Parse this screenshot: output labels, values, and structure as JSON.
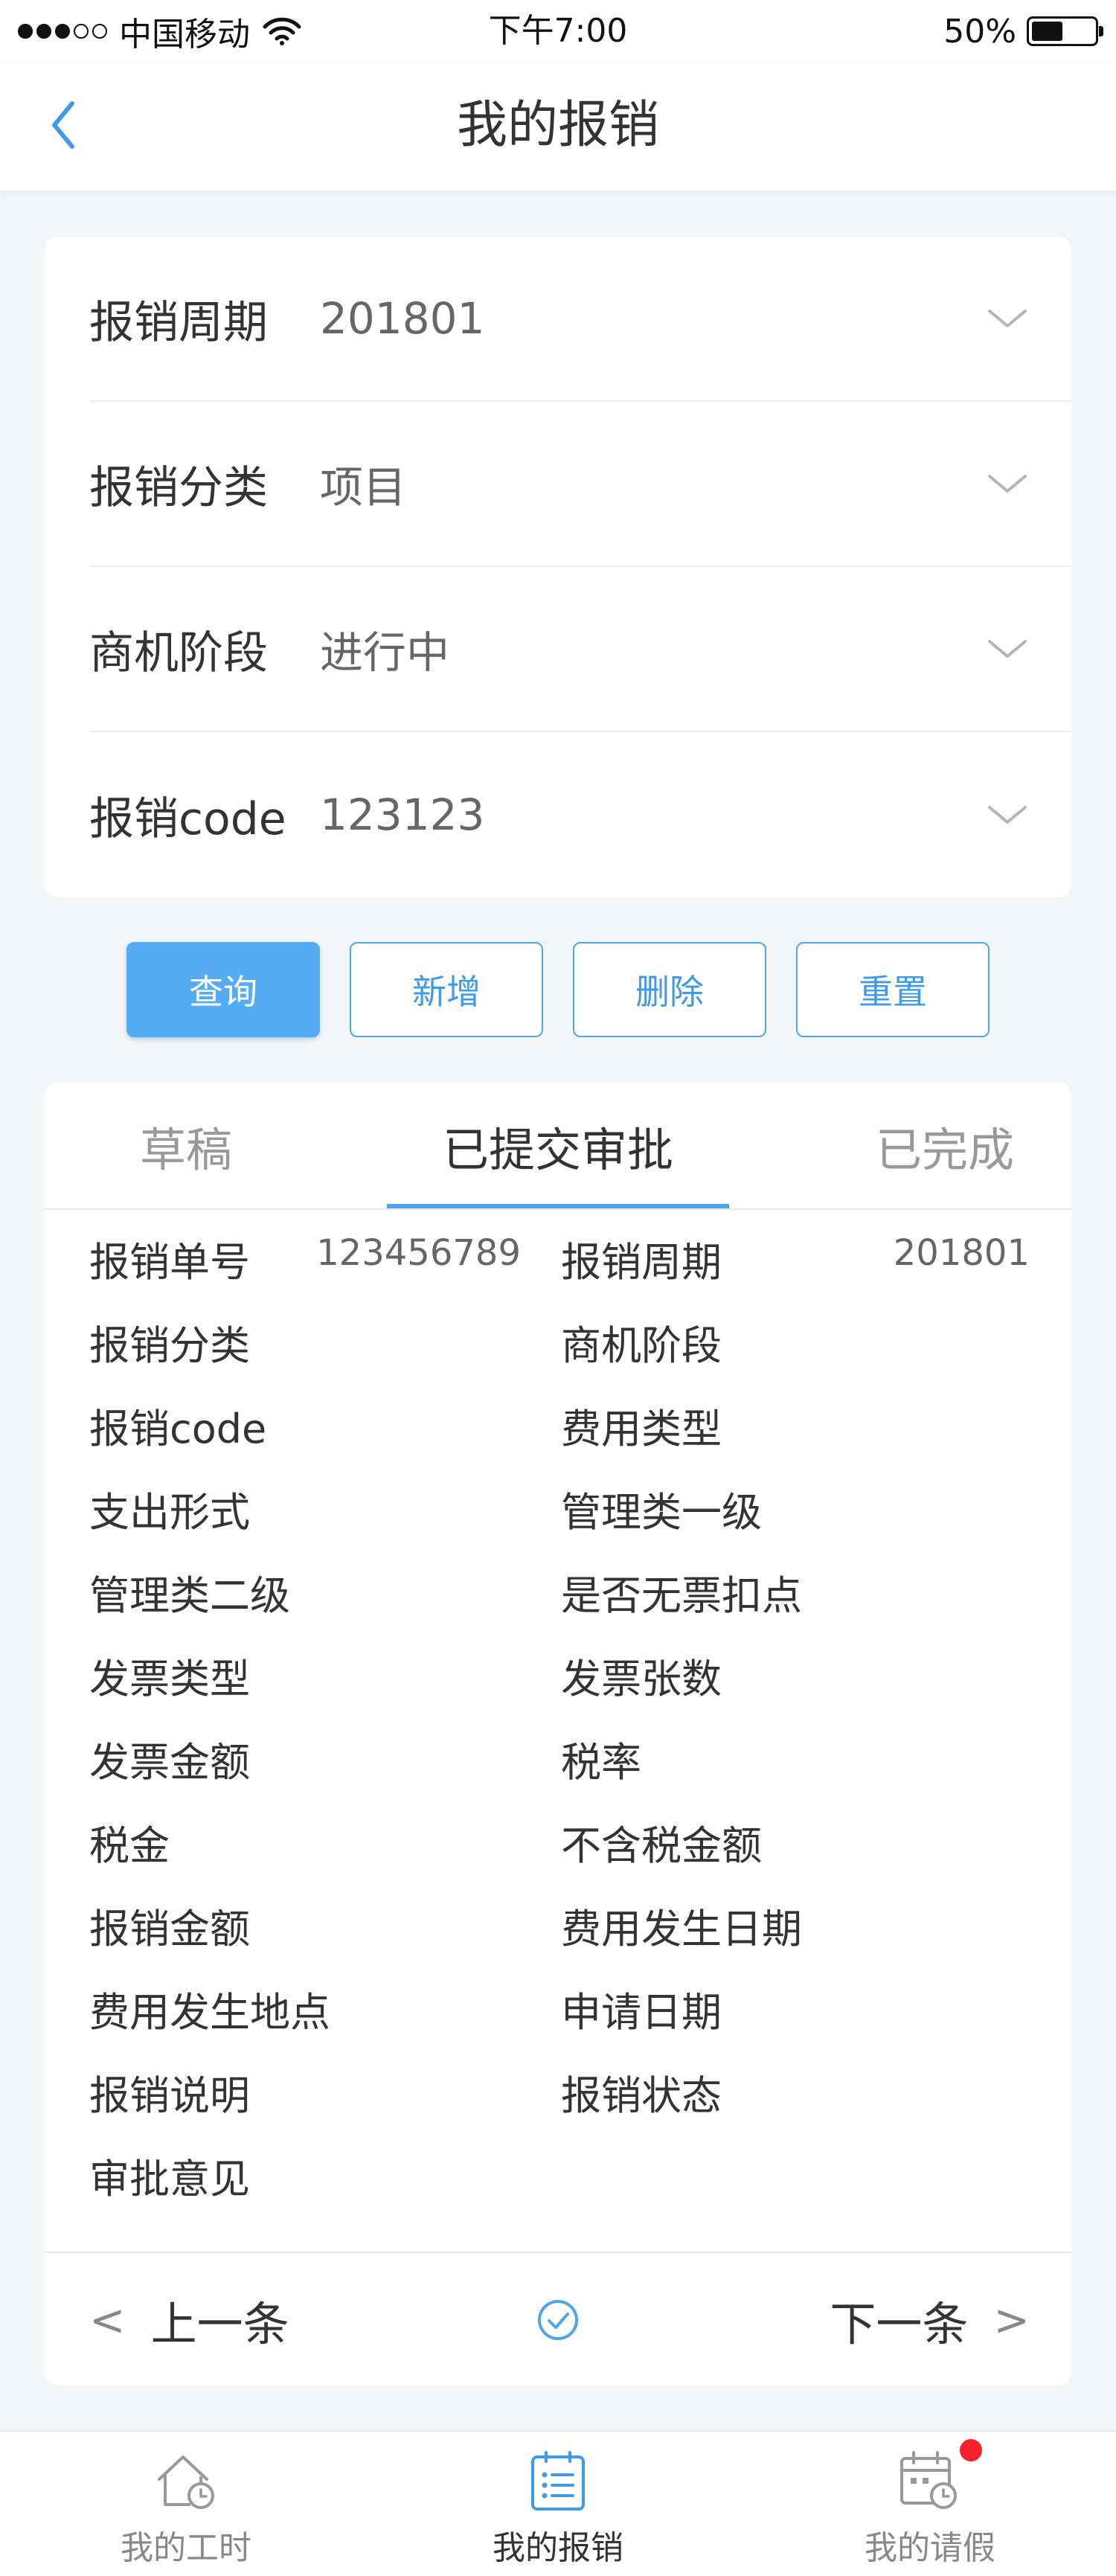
{
  "status_bar": {
    "carrier": "中国移动",
    "time": "下午7:00",
    "battery": "50%",
    "battery_level": 0.5
  },
  "nav": {
    "title": "我的报销",
    "back_icon": "chevron-left-icon"
  },
  "filters": [
    {
      "label": "报销周期",
      "value": "201801"
    },
    {
      "label": "报销分类",
      "value": "项目"
    },
    {
      "label": "商机阶段",
      "value": "进行中"
    },
    {
      "label": "报销code",
      "value": "123123"
    }
  ],
  "actions": {
    "query": "查询",
    "add": "新增",
    "delete": "删除",
    "reset": "重置"
  },
  "tabs": [
    {
      "label": "草稿",
      "active": false
    },
    {
      "label": "已提交审批",
      "active": true
    },
    {
      "label": "已完成",
      "active": false
    }
  ],
  "details": {
    "left": [
      {
        "label": "报销单号",
        "value": "123456789"
      },
      {
        "label": "报销分类",
        "value": ""
      },
      {
        "label": "报销code",
        "value": ""
      },
      {
        "label": "支出形式",
        "value": ""
      },
      {
        "label": "管理类二级",
        "value": ""
      },
      {
        "label": "发票类型",
        "value": ""
      },
      {
        "label": "发票金额",
        "value": ""
      },
      {
        "label": "税金",
        "value": ""
      },
      {
        "label": "报销金额",
        "value": ""
      },
      {
        "label": "费用发生地点",
        "value": ""
      },
      {
        "label": "报销说明",
        "value": ""
      },
      {
        "label": "审批意见",
        "value": ""
      }
    ],
    "right": [
      {
        "label": "报销周期",
        "value": "201801"
      },
      {
        "label": "商机阶段",
        "value": ""
      },
      {
        "label": "费用类型",
        "value": ""
      },
      {
        "label": "管理类一级",
        "value": ""
      },
      {
        "label": "是否无票扣点",
        "value": ""
      },
      {
        "label": "发票张数",
        "value": ""
      },
      {
        "label": "税率",
        "value": ""
      },
      {
        "label": "不含税金额",
        "value": ""
      },
      {
        "label": "费用发生日期",
        "value": ""
      },
      {
        "label": "申请日期",
        "value": ""
      },
      {
        "label": "报销状态",
        "value": ""
      }
    ]
  },
  "pager": {
    "prev_arrow": "<",
    "prev": "上一条",
    "next": "下一条",
    "next_arrow": ">"
  },
  "tabbar": [
    {
      "label": "我的工时",
      "icon": "house-clock-icon",
      "active": false
    },
    {
      "label": "我的报销",
      "icon": "list-document-icon",
      "active": true
    },
    {
      "label": "我的请假",
      "icon": "calendar-clock-icon",
      "active": false,
      "badge": true
    }
  ],
  "colors": {
    "accent": "#4ea5ef",
    "primary_button": "#55acf5",
    "badge": "#f5222d",
    "background": "#f4f5f7"
  }
}
